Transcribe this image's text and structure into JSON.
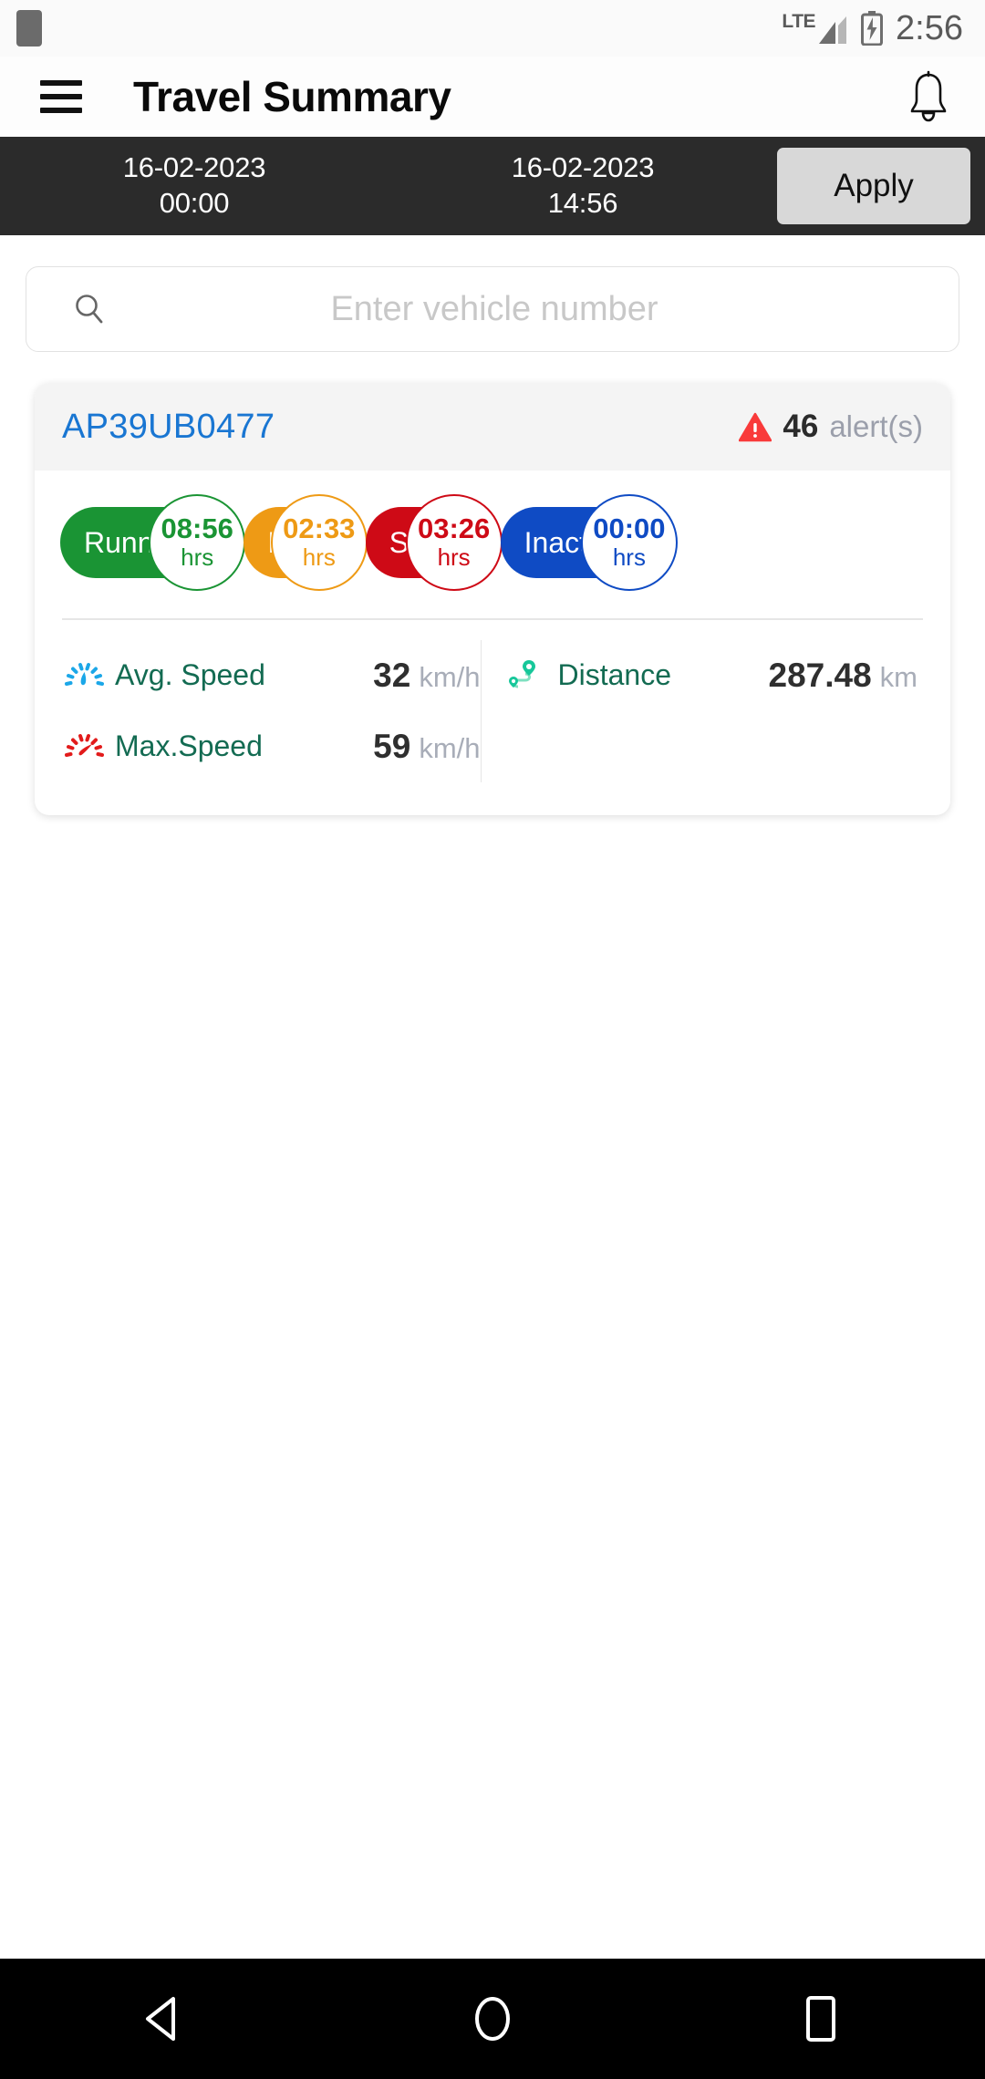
{
  "status_bar": {
    "notification_icon": "app-notification-square",
    "network_label": "LTE",
    "signal_icon": "signal-bars-icon",
    "battery_icon": "battery-charging-icon",
    "time": "2:56"
  },
  "app_bar": {
    "menu_icon": "hamburger-menu-icon",
    "title": "Travel Summary",
    "bell_icon": "notification-bell-icon"
  },
  "date_filter": {
    "from_date": "16-02-2023",
    "from_time": "00:00",
    "to_date": "16-02-2023",
    "to_time": "14:56",
    "apply_label": "Apply",
    "bar_color": "#2b2b2b",
    "apply_bg": "#d8d8d8"
  },
  "search": {
    "icon": "search-icon",
    "placeholder": "Enter vehicle number",
    "value": ""
  },
  "vehicle_card": {
    "vehicle_number": "AP39UB0477",
    "vehicle_number_color": "#1976d2",
    "alert_icon": "warning-triangle-icon",
    "alert_count": "46",
    "alert_label": "alert(s)",
    "statuses": [
      {
        "label": "Running",
        "time": "08:56",
        "unit": "hrs",
        "color": "#1a9434"
      },
      {
        "label": "Idle",
        "time": "02:33",
        "unit": "hrs",
        "color": "#ee9a15"
      },
      {
        "label": "Stop",
        "time": "03:26",
        "unit": "hrs",
        "color": "#ce0a16"
      },
      {
        "label": "Inactive",
        "time": "00:00",
        "unit": "hrs",
        "color": "#0f4bc4"
      }
    ],
    "stats_left": [
      {
        "icon": "speedometer-blue-icon",
        "label": "Avg. Speed",
        "value": "32",
        "unit": "km/h"
      },
      {
        "icon": "speedometer-red-icon",
        "label": "Max.Speed",
        "value": "59",
        "unit": "km/h"
      }
    ],
    "stats_right": [
      {
        "icon": "route-distance-icon",
        "label": "Distance",
        "value": "287.48",
        "unit": "km"
      }
    ]
  },
  "nav_bar": {
    "back_icon": "back-triangle-icon",
    "home_icon": "home-circle-icon",
    "recents_icon": "recents-square-icon"
  }
}
